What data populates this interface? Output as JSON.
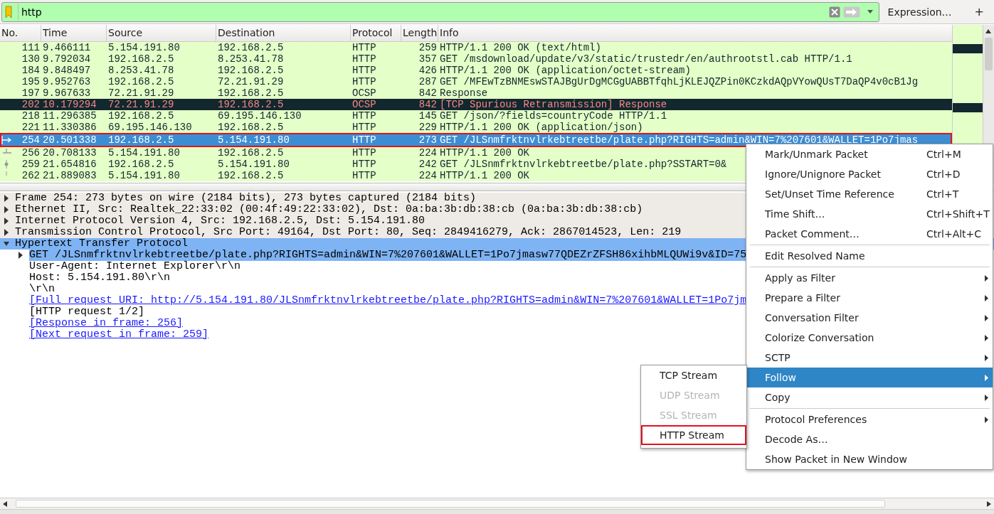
{
  "filter": {
    "value": "http",
    "expression_label": "Expression…",
    "add_label": "+"
  },
  "packet_list": {
    "columns": [
      "No.",
      "Time",
      "Source",
      "Destination",
      "Protocol",
      "Length",
      "Info"
    ],
    "rows": [
      {
        "no": "111",
        "time": "9.466111",
        "source": "5.154.191.80",
        "destination": "192.168.2.5",
        "protocol": "HTTP",
        "length": "259",
        "info": "HTTP/1.1 200 OK  (text/html)",
        "kind": "normal",
        "selected": false,
        "annotated": false
      },
      {
        "no": "130",
        "time": "9.792034",
        "source": "192.168.2.5",
        "destination": "8.253.41.78",
        "protocol": "HTTP",
        "length": "357",
        "info": "GET /msdownload/update/v3/static/trustedr/en/authrootstl.cab HTTP/1.1",
        "kind": "normal",
        "selected": false,
        "annotated": false
      },
      {
        "no": "184",
        "time": "9.848497",
        "source": "8.253.41.78",
        "destination": "192.168.2.5",
        "protocol": "HTTP",
        "length": "426",
        "info": "HTTP/1.1 200 OK  (application/octet-stream)",
        "kind": "normal",
        "selected": false,
        "annotated": false
      },
      {
        "no": "195",
        "time": "9.952763",
        "source": "192.168.2.5",
        "destination": "72.21.91.29",
        "protocol": "HTTP",
        "length": "287",
        "info": "GET /MFEwTzBNMEswSTAJBgUrDgMCGgUABBTfqhLjKLEJQZPin0KCzkdAQpVYowQUsT7DaQP4v0cB1Jg",
        "kind": "normal",
        "selected": false,
        "annotated": false
      },
      {
        "no": "197",
        "time": "9.967633",
        "source": "72.21.91.29",
        "destination": "192.168.2.5",
        "protocol": "OCSP",
        "length": "842",
        "info": "Response",
        "kind": "normal",
        "selected": false,
        "annotated": false
      },
      {
        "no": "202",
        "time": "10.179294",
        "source": "72.21.91.29",
        "destination": "192.168.2.5",
        "protocol": "OCSP",
        "length": "842",
        "info": "[TCP Spurious Retransmission] Response",
        "kind": "error",
        "selected": false,
        "annotated": false
      },
      {
        "no": "218",
        "time": "11.296385",
        "source": "192.168.2.5",
        "destination": "69.195.146.130",
        "protocol": "HTTP",
        "length": "145",
        "info": "GET /json/?fields=countryCode HTTP/1.1",
        "kind": "normal",
        "selected": false,
        "annotated": false
      },
      {
        "no": "221",
        "time": "11.330386",
        "source": "69.195.146.130",
        "destination": "192.168.2.5",
        "protocol": "HTTP",
        "length": "229",
        "info": "HTTP/1.1 200 OK  (application/json)",
        "kind": "normal",
        "selected": false,
        "annotated": false
      },
      {
        "no": "254",
        "time": "20.501338",
        "source": "192.168.2.5",
        "destination": "5.154.191.80",
        "protocol": "HTTP",
        "length": "273",
        "info": "GET /JLSnmfrktnvlrkebtreetbe/plate.php?RIGHTS=admin&WIN=7%207601&WALLET=1Po7jmas",
        "kind": "request",
        "selected": true,
        "annotated": true
      },
      {
        "no": "256",
        "time": "20.708133",
        "source": "5.154.191.80",
        "destination": "192.168.2.5",
        "protocol": "HTTP",
        "length": "224",
        "info": "HTTP/1.1 200 OK",
        "kind": "response",
        "selected": false,
        "annotated": false
      },
      {
        "no": "259",
        "time": "21.654816",
        "source": "192.168.2.5",
        "destination": "5.154.191.80",
        "protocol": "HTTP",
        "length": "242",
        "info": "GET /JLSnmfrktnvlrkebtreetbe/plate.php?SSTART=0&",
        "kind": "related",
        "selected": false,
        "annotated": false
      },
      {
        "no": "262",
        "time": "21.889083",
        "source": "5.154.191.80",
        "destination": "192.168.2.5",
        "protocol": "HTTP",
        "length": "224",
        "info": "HTTP/1.1 200 OK",
        "kind": "continuation",
        "selected": false,
        "annotated": false
      }
    ]
  },
  "details": [
    {
      "text": "Frame 254: 273 bytes on wire (2184 bits), 273 bytes captured (2184 bits)",
      "kind": "header",
      "expanded": false,
      "selected": false
    },
    {
      "text": "Ethernet II, Src: Realtek_22:33:02 (00:4f:49:22:33:02), Dst: 0a:ba:3b:db:38:cb (0a:ba:3b:db:38:cb)",
      "kind": "header",
      "expanded": false,
      "selected": false
    },
    {
      "text": "Internet Protocol Version 4, Src: 192.168.2.5, Dst: 5.154.191.80",
      "kind": "header",
      "expanded": false,
      "selected": false
    },
    {
      "text": "Transmission Control Protocol, Src Port: 49164, Dst Port: 80, Seq: 2849416279, Ack: 2867014523, Len: 219",
      "kind": "header",
      "expanded": false,
      "selected": false
    },
    {
      "text": "Hypertext Transfer Protocol",
      "kind": "header",
      "expanded": true,
      "selected": true,
      "children": [
        {
          "text": "GET /JLSnmfrktnvlrkebtreetbe/plate.php?RIGHTS=admin&WIN=7%207601&WALLET=1Po7jmasw77QDEZrZFSH86xihbMLQUWi9v&ID=75",
          "kind": "plain",
          "expanded": false,
          "selected": true
        },
        {
          "text": "User-Agent: Internet Explorer\\r\\n",
          "kind": "plain",
          "selected": false
        },
        {
          "text": "Host: 5.154.191.80\\r\\n",
          "kind": "plain",
          "selected": false
        },
        {
          "text": "\\r\\n",
          "kind": "plain",
          "selected": false
        },
        {
          "text": "[Full request URI: http://5.154.191.80/JLSnmfrktnvlrkebtreetbe/plate.php?RIGHTS=admin&WIN=7%207601&WALLET=1Po7jm",
          "kind": "link",
          "selected": false
        },
        {
          "text": "[HTTP request 1/2]",
          "kind": "plain",
          "selected": false
        },
        {
          "text": "[Response in frame: 256]",
          "kind": "link",
          "selected": false
        },
        {
          "text": "[Next request in frame: 259]",
          "kind": "link",
          "selected": false
        }
      ]
    }
  ],
  "context_menu": [
    {
      "kind": "item",
      "label": "Mark/Unmark Packet",
      "shortcut": "Ctrl+M",
      "submenu": false,
      "selected": false
    },
    {
      "kind": "item",
      "label": "Ignore/Unignore Packet",
      "shortcut": "Ctrl+D",
      "submenu": false,
      "selected": false
    },
    {
      "kind": "item",
      "label": "Set/Unset Time Reference",
      "shortcut": "Ctrl+T",
      "submenu": false,
      "selected": false
    },
    {
      "kind": "item",
      "label": "Time Shift…",
      "shortcut": "Ctrl+Shift+T",
      "submenu": false,
      "selected": false
    },
    {
      "kind": "item",
      "label": "Packet Comment…",
      "shortcut": "Ctrl+Alt+C",
      "submenu": false,
      "selected": false
    },
    {
      "kind": "separator"
    },
    {
      "kind": "item",
      "label": "Edit Resolved Name",
      "submenu": false,
      "selected": false
    },
    {
      "kind": "separator"
    },
    {
      "kind": "item",
      "label": "Apply as Filter",
      "submenu": true,
      "selected": false
    },
    {
      "kind": "item",
      "label": "Prepare a Filter",
      "submenu": true,
      "selected": false
    },
    {
      "kind": "item",
      "label": "Conversation Filter",
      "submenu": true,
      "selected": false
    },
    {
      "kind": "item",
      "label": "Colorize Conversation",
      "submenu": true,
      "selected": false
    },
    {
      "kind": "item",
      "label": "SCTP",
      "submenu": true,
      "selected": false
    },
    {
      "kind": "item",
      "label": "Follow",
      "submenu": true,
      "selected": true
    },
    {
      "kind": "item",
      "label": "Copy",
      "submenu": true,
      "selected": false
    },
    {
      "kind": "separator"
    },
    {
      "kind": "item",
      "label": "Protocol Preferences",
      "submenu": true,
      "selected": false
    },
    {
      "kind": "item",
      "label": "Decode As…",
      "submenu": false,
      "selected": false
    },
    {
      "kind": "item",
      "label": "Show Packet in New Window",
      "submenu": false,
      "selected": false
    }
  ],
  "follow_submenu": [
    {
      "label": "TCP Stream",
      "disabled": false,
      "annotated": false
    },
    {
      "label": "UDP Stream",
      "disabled": true,
      "annotated": false
    },
    {
      "label": "SSL Stream",
      "disabled": true,
      "annotated": false
    },
    {
      "label": "HTTP Stream",
      "disabled": false,
      "annotated": true
    }
  ]
}
